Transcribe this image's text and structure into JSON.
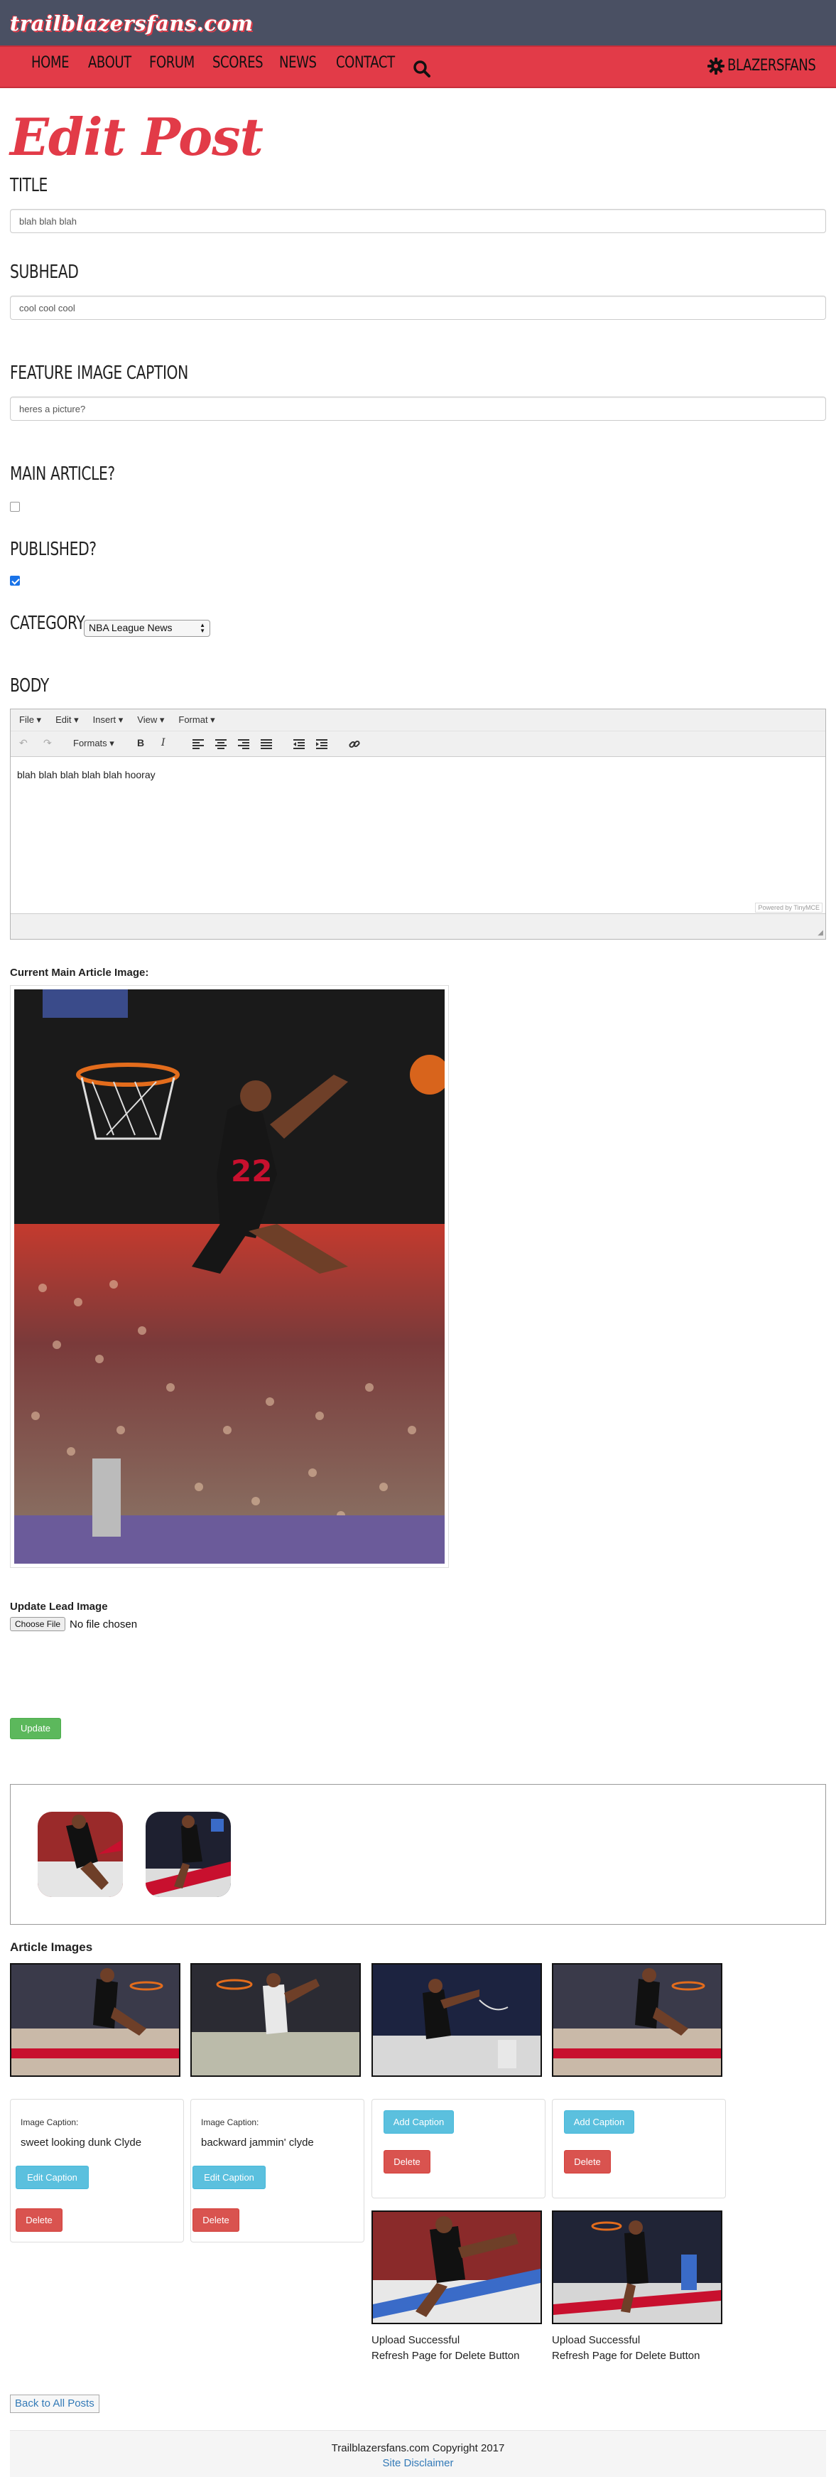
{
  "header": {
    "brand": "trailblazersfans.com",
    "nav": [
      "HOME",
      "ABOUT",
      "FORUM",
      "SCORES",
      "NEWS",
      "CONTACT"
    ],
    "brand_link": "BLAZERSFANS",
    "icons": {
      "search": "search-icon",
      "brand": "gear-icon"
    }
  },
  "page": {
    "title": "Edit Post"
  },
  "form": {
    "title_label": "TITLE",
    "title_value": "blah blah blah",
    "subhead_label": "SUBHEAD",
    "subhead_value": "cool cool cool",
    "caption_label": "FEATURE IMAGE CAPTION",
    "caption_value": "heres a picture?",
    "main_article_label": "MAIN ARTICLE?",
    "main_article_checked": false,
    "published_label": "PUBLISHED?",
    "published_checked": true,
    "category_label": "CATEGORY",
    "category_value": "NBA League News",
    "body_label": "BODY"
  },
  "editor": {
    "menu": [
      "File ▾",
      "Edit ▾",
      "Insert ▾",
      "View ▾",
      "Format ▾"
    ],
    "formats_label": "Formats ▾",
    "content": "blah blah blah blah blah hooray",
    "powered_by": "Powered by TinyMCE"
  },
  "main_image": {
    "label": "Current Main Article Image:"
  },
  "update_lead": {
    "label": "Update Lead Image",
    "file_button": "Choose File",
    "file_status": "No file chosen"
  },
  "buttons": {
    "update": "Update",
    "back": "Back to All Posts"
  },
  "article_images": {
    "heading": "Article Images",
    "cards": [
      {
        "caption_label": "Image Caption:",
        "caption": "sweet looking dunk Clyde",
        "edit": "Edit Caption",
        "delete": "Delete"
      },
      {
        "caption_label": "Image Caption:",
        "caption": "backward jammin' clyde",
        "edit": "Edit Caption",
        "delete": "Delete"
      },
      {
        "add": "Add Caption",
        "delete": "Delete"
      },
      {
        "add": "Add Caption",
        "delete": "Delete"
      }
    ],
    "uploads": [
      {
        "line1": "Upload Successful",
        "line2": "Refresh Page for Delete Button"
      },
      {
        "line1": "Upload Successful",
        "line2": "Refresh Page for Delete Button"
      }
    ]
  },
  "footer": {
    "copyright": "Trailblazersfans.com Copyright 2017",
    "disclaimer": "Site Disclaimer"
  },
  "colors": {
    "brand_red": "#e23b48",
    "header_slate": "#4a5063",
    "success": "#5cb85c",
    "info": "#5bc0de",
    "danger": "#d9534f"
  }
}
